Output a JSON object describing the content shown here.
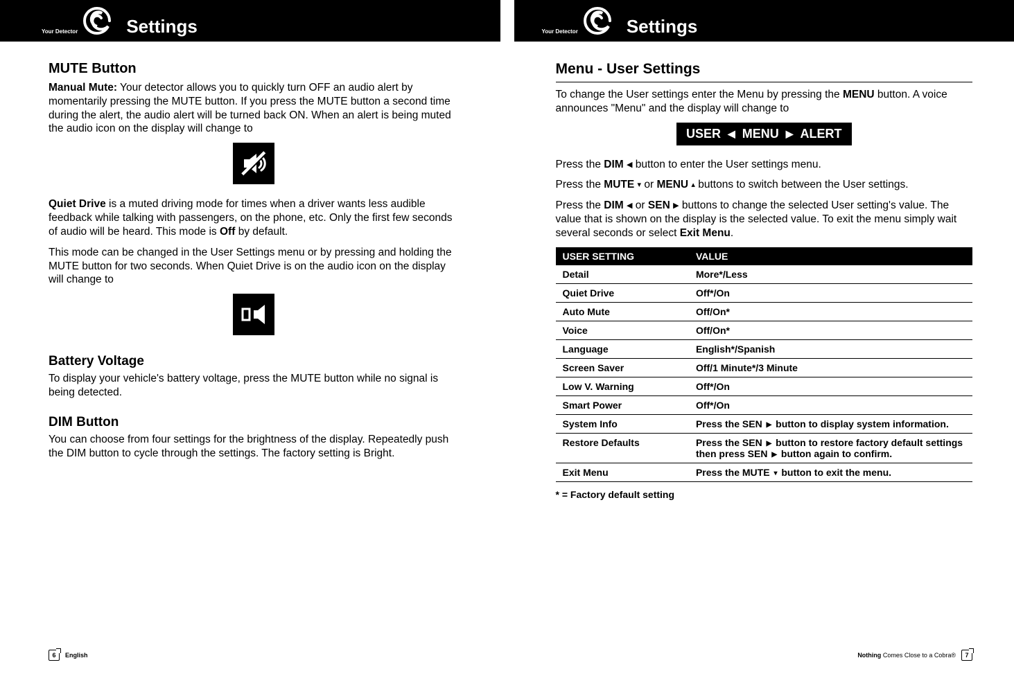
{
  "logo_label": "Your Detector",
  "left": {
    "section_title": "Settings",
    "h_mute": "MUTE Button",
    "p_manual_mute_label": "Manual Mute:",
    "p_manual_mute": " Your detector allows you to quickly turn OFF an audio alert by momentarily pressing the MUTE button. If you press the MUTE button a second time during the alert, the audio alert will be turned back ON. When an alert is being muted the audio icon on the display will change to",
    "p_quiet_label": "Quiet Drive",
    "p_quiet_1": " is a muted driving mode for times when a driver wants less audible feedback while talking with passengers, on the phone, etc. Only the first few seconds of audio will be heard. This mode is ",
    "p_quiet_off": "Off",
    "p_quiet_2": " by default.",
    "p_quiet_change": "This mode can be changed in the User Settings menu or by pressing and holding the MUTE button for two seconds. When Quiet Drive is on the audio icon on the display will change to",
    "h_batt": "Battery Voltage",
    "p_batt": "To display your vehicle's battery voltage, press the MUTE button while no signal is being detected.",
    "h_dim": "DIM Button",
    "p_dim": "You can choose from four settings for the brightness of the display. Repeatedly push the DIM button to cycle through the settings. The factory setting is Bright.",
    "page_num": "6",
    "foot_label": "English"
  },
  "right": {
    "section_title": "Settings",
    "h_menu": "Menu - User Settings",
    "p_intro_1": "To change the User settings enter the Menu by pressing the ",
    "p_intro_menu": "MENU",
    "p_intro_2": " button. A voice announces \"Menu\" and the display will change to",
    "display": {
      "left": "USER",
      "center": "MENU",
      "right": "ALERT"
    },
    "p_dim_1": "Press the ",
    "p_dim_btn": "DIM",
    "p_dim_2": " button to enter the User settings menu.",
    "p_mute_1": "Press the ",
    "p_mute_btn": "MUTE",
    "p_mute_or": " or ",
    "p_menu_btn": "MENU",
    "p_mute_2": " buttons to switch between the User settings.",
    "p_sen_1": "Press the ",
    "p_sen_dim": "DIM",
    "p_sen_or": " or ",
    "p_sen_sen": "SEN",
    "p_sen_2": " buttons to change the selected User setting's value. The value that is shown on the display is the selected value. To exit the menu simply wait several seconds or select ",
    "p_sen_exit": "Exit Menu",
    "p_sen_3": ".",
    "table": {
      "head_setting": "USER SETTING",
      "head_value": "VALUE",
      "rows": [
        {
          "setting": "Detail",
          "value": "More*/Less"
        },
        {
          "setting": "Quiet Drive",
          "value": "Off*/On"
        },
        {
          "setting": "Auto Mute",
          "value": "Off/On*"
        },
        {
          "setting": "Voice",
          "value": "Off/On*"
        },
        {
          "setting": "Language",
          "value": "English*/Spanish"
        },
        {
          "setting": "Screen Saver",
          "value": "Off/1 Minute*/3 Minute"
        },
        {
          "setting": "Low V. Warning",
          "value": "Off*/On"
        },
        {
          "setting": "Smart Power",
          "value": "Off*/On"
        },
        {
          "setting": "System Info",
          "value_prefix": "Press the SEN ",
          "value_suffix": " button to display system information."
        },
        {
          "setting": "Restore Defaults",
          "value_prefix": "Press the SEN ",
          "value_mid": " button to restore factory default settings then press SEN ",
          "value_suffix": " button again to confirm."
        },
        {
          "setting": "Exit Menu",
          "value_prefix": "Press the MUTE ",
          "value_suffix": " button to exit the menu."
        }
      ]
    },
    "footnote": "* = Factory default setting",
    "page_num": "7",
    "foot_tag_bold": "Nothing",
    "foot_tag_rest": " Comes Close to a Cobra®"
  }
}
